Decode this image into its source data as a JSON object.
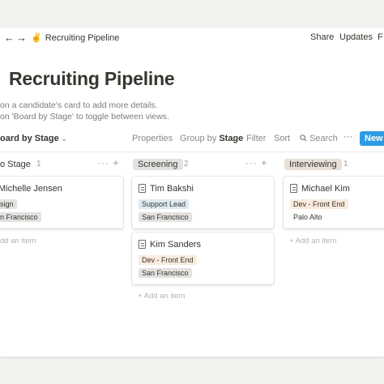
{
  "topbar": {
    "back_icon": "arrow-left-icon",
    "forward_icon": "arrow-right-icon",
    "emoji": "✌️",
    "title": "Recruiting Pipeline",
    "share": "Share",
    "updates": "Updates",
    "more": "F"
  },
  "page": {
    "title": "Recruiting Pipeline",
    "desc1": "on a candidate's card to add more details.",
    "desc2": "on 'Board by Stage' to toggle between views."
  },
  "toolbar": {
    "view": "oard by Stage",
    "properties": "Properties",
    "group_by_label": "Group by",
    "group_by_value": "Stage",
    "filter": "Filter",
    "sort": "Sort",
    "search": "Search",
    "more": "···",
    "new": "New"
  },
  "colors": {
    "support_lead": "#ddebf1",
    "san_francisco": "#e3e2e0",
    "dev_front_end": "#faebdd",
    "design": "#e3e2e0",
    "palo_alto": "#e3e2e0",
    "interviewing": "#e8dfd7",
    "screening": "#e3e2e0",
    "new_button": "#2e9be4"
  },
  "columns": {
    "no_stage": {
      "label": "o Stage",
      "count": "1",
      "cards": [
        {
          "name": "Michelle Jensen",
          "tags": [
            "sign",
            "n Francisco"
          ]
        }
      ],
      "add": "dd an item"
    },
    "screening": {
      "label": "Screening",
      "count": "2",
      "icons": "··· +",
      "cards": [
        {
          "name": "Tim Bakshi",
          "tags": [
            "Support Lead",
            "San Francisco"
          ]
        },
        {
          "name": "Kim Sanders",
          "tags": [
            "Dev - Front End",
            "San Francisco"
          ]
        }
      ],
      "add": "+ Add an item"
    },
    "interviewing": {
      "label": "Interviewing",
      "count": "1",
      "cards": [
        {
          "name": "Michael Kim",
          "tags": [
            "Dev - Front End",
            "Palo Alto"
          ]
        }
      ],
      "add": "+ Add an item"
    }
  },
  "no_stage_icons": "··· +"
}
